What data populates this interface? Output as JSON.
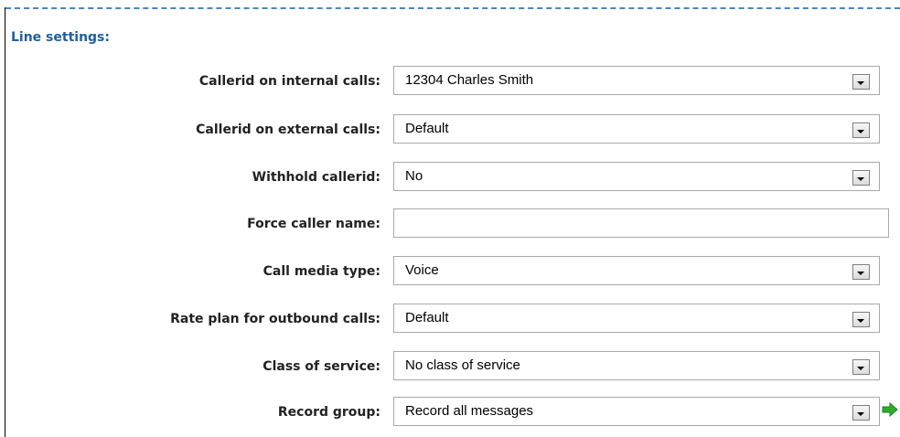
{
  "section": {
    "title": "Line settings:"
  },
  "fields": [
    {
      "label": "Callerid on internal calls:",
      "value": "12304 Charles Smith"
    },
    {
      "label": "Callerid on external calls:",
      "value": "Default"
    },
    {
      "label": "Withhold callerid:",
      "value": "No"
    },
    {
      "label": "Force caller name:",
      "value": ""
    },
    {
      "label": "Call media type:",
      "value": "Voice"
    },
    {
      "label": "Rate plan for outbound calls:",
      "value": "Default"
    },
    {
      "label": "Class of service:",
      "value": "No class of service"
    },
    {
      "label": "Record group:",
      "value": "Record all messages"
    }
  ],
  "icons": {
    "dropdown": "chevron-down-icon",
    "go": "green-arrow-right-icon"
  },
  "colors": {
    "section_title": "#1f5f9c",
    "dashed_border": "#4a86c0",
    "go_arrow": "#2eae2e"
  }
}
